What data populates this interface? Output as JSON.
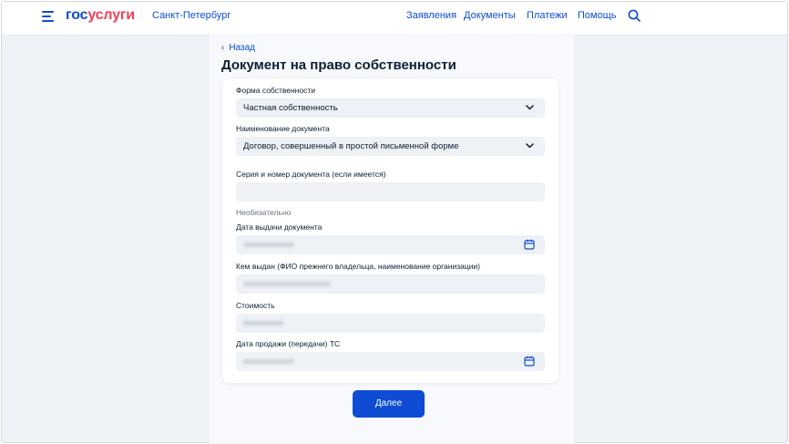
{
  "header": {
    "logo_part1": "гос",
    "logo_part2": "услуги",
    "region": "Санкт-Петербург",
    "nav": [
      "Заявления",
      "Документы",
      "Платежи",
      "Помощь"
    ]
  },
  "page": {
    "back_label": "Назад",
    "title": "Документ на право собственности"
  },
  "form": {
    "ownership_form": {
      "label": "Форма собственности",
      "value": "Частная собственность"
    },
    "document_name": {
      "label": "Наименование документа",
      "value": "Договор, совершенный в простой письменной форме"
    },
    "doc_series_number": {
      "label": "Серия и номер документа (если имеется)",
      "value": ""
    },
    "optional_note": "Необязательно",
    "issue_date": {
      "label": "Дата выдачи документа"
    },
    "issued_by": {
      "label": "Кем выдан (ФИО прежнего владельца, наименование организации)"
    },
    "cost": {
      "label": "Стоимость"
    },
    "sale_date": {
      "label": "Дата продажи (передачи) ТС"
    }
  },
  "submit_label": "Далее",
  "colors": {
    "accent": "#0d4cd3",
    "logo_red": "#ee3f58",
    "text": "#0b1f33"
  }
}
